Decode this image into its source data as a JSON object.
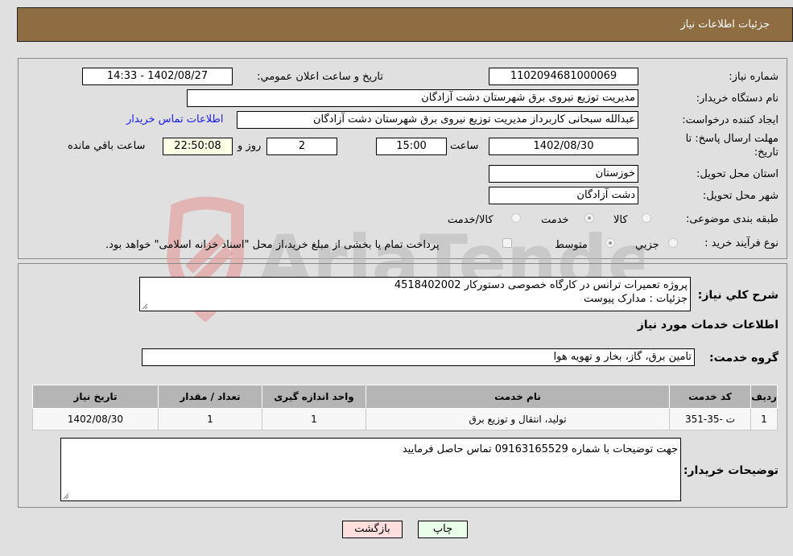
{
  "header": {
    "title": "جزئیات اطلاعات نیاز"
  },
  "form": {
    "need_number_label": "شماره نیاز:",
    "need_number": "1102094681000069",
    "announce_label": "تاريخ و ساعت اعلان عمومي:",
    "announce_value": "1402/08/27 - 14:33",
    "buyer_org_label": "نام دستگاه خریدار:",
    "buyer_org": "مدیریت توزیع نیروی برق شهرستان دشت آزادگان",
    "creator_label": "ایجاد کننده درخواست:",
    "creator": "عبدالله سبحانی کاربرداز مدیریت توزیع نیروی برق شهرستان دشت آزادگان",
    "buyer_contact_link": "اطلاعات تماس خریدار",
    "deadline_label_line1": "مهلت ارسال پاسخ: تا",
    "deadline_label_line2": "تاریخ:",
    "deadline_date": "1402/08/30",
    "time_label": "ساعت",
    "deadline_time": "15:00",
    "days": "2",
    "days_label": "روز و",
    "remaining_time": "22:50:08",
    "remaining_label": "ساعت باقي مانده",
    "province_label": "استان محل تحویل:",
    "province": "خوزستان",
    "city_label": "شهر محل تحویل:",
    "city": "دشت آزادگان",
    "category_label": "طبقه بندی موضوعی:",
    "category_options": [
      {
        "label": "کالا",
        "selected": false
      },
      {
        "label": "خدمت",
        "selected": true
      },
      {
        "label": "کالا/خدمت",
        "selected": false
      }
    ],
    "process_label": "نوع فرآیند خرید :",
    "process_options": [
      {
        "label": "جزيي",
        "selected": false
      },
      {
        "label": "متوسط",
        "selected": true
      }
    ],
    "payment_note": "پرداخت تمام یا بخشی از مبلغ خرید،از محل \"اسناد خزانه اسلامی\" خواهد بود."
  },
  "details": {
    "description_label": "شرح کلي نياز:",
    "description_line1": "پروژه  تعمیرات ترانس در کارگاه خصوصی دستورکار 4518402002",
    "description_line2": "جزئیات : مدارک پیوست",
    "services_heading": "اطلاعات خدمات مورد نیاز",
    "service_group_label": "گروه خدمت:",
    "service_group": "تامین برق، گاز، بخار و تهویه هوا",
    "table": {
      "headers": [
        "رديف",
        "کد خدمت",
        "نام خدمت",
        "واحد اندازه گيری",
        "تعداد / مقدار",
        "تاريخ نياز"
      ],
      "rows": [
        [
          "1",
          "ت -35-351",
          "تولید، انتقال و توزیع برق",
          "1",
          "1",
          "1402/08/30"
        ]
      ]
    },
    "buyer_notes_label": "توضیحات خریدار:",
    "buyer_notes": "جهت توضیحات با شماره 09163165529 تماس حاصل فرمایید"
  },
  "buttons": {
    "print": "چاپ",
    "back": "بازگشت"
  },
  "watermark": {
    "text": "AriaTender.neT"
  },
  "colors": {
    "header_bg": "#8e6d42",
    "print_bg": "#eaffea",
    "back_bg": "#ffdede",
    "link": "#1a1aff"
  }
}
